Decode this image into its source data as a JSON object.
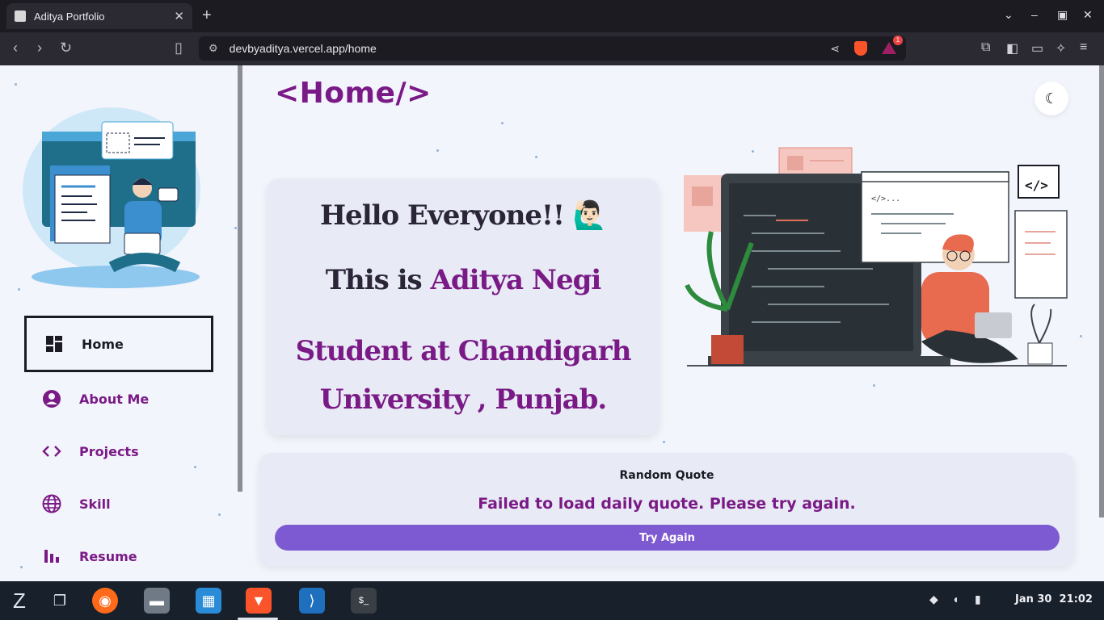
{
  "browser": {
    "tab_title": "Aditya Portfolio",
    "tab_close": "✕",
    "new_tab": "+",
    "url": "devbyaditya.vercel.app/home",
    "rewards_badge": "1"
  },
  "sidebar": {
    "items": [
      {
        "label": "Home",
        "icon": "dashboard-icon"
      },
      {
        "label": "About Me",
        "icon": "user-circle-icon"
      },
      {
        "label": "Projects",
        "icon": "code-icon"
      },
      {
        "label": "Skill",
        "icon": "globe-icon"
      },
      {
        "label": "Resume",
        "icon": "bar-chart-icon"
      }
    ]
  },
  "main": {
    "page_title": "<Home/>",
    "hello": "Hello Everyone!! 🙋🏻‍♂️",
    "intro_prefix": "This is ",
    "name": "Aditya Negi",
    "student_line1": "Student at Chandigarh",
    "student_line2": "University , Punjab."
  },
  "quote": {
    "label": "Random Quote",
    "error": "Failed to load daily quote. Please try again.",
    "button": "Try Again"
  },
  "taskbar": {
    "date": "Jan 30",
    "time": "21:02"
  },
  "colors": {
    "accent": "#7a1a86",
    "button": "#7d59d2",
    "page_bg": "#f3f5fc",
    "card_bg": "#e8ebf6"
  }
}
